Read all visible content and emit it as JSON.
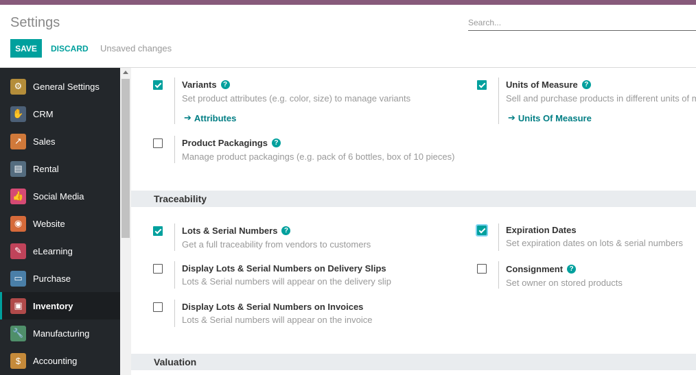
{
  "header": {
    "title": "Settings",
    "search_placeholder": "Search...",
    "save_label": "SAVE",
    "discard_label": "DISCARD",
    "unsaved_text": "Unsaved changes"
  },
  "sidebar": {
    "items": [
      {
        "label": "General Settings",
        "icon": "gear-icon",
        "color": "#b48d3a"
      },
      {
        "label": "CRM",
        "icon": "handshake-icon",
        "color": "#4c6077"
      },
      {
        "label": "Sales",
        "icon": "chart-icon",
        "color": "#d0793a"
      },
      {
        "label": "Rental",
        "icon": "rental-icon",
        "color": "#546c7f"
      },
      {
        "label": "Social Media",
        "icon": "thumbs-up-icon",
        "color": "#d54a74"
      },
      {
        "label": "Website",
        "icon": "globe-icon",
        "color": "#d56a3a"
      },
      {
        "label": "eLearning",
        "icon": "elearning-icon",
        "color": "#c0435a"
      },
      {
        "label": "Purchase",
        "icon": "credit-card-icon",
        "color": "#4a7fa8"
      },
      {
        "label": "Inventory",
        "icon": "box-icon",
        "color": "#b04a4a",
        "active": true
      },
      {
        "label": "Manufacturing",
        "icon": "wrench-icon",
        "color": "#4f8f6a"
      },
      {
        "label": "Accounting",
        "icon": "invoice-icon",
        "color": "#c58a3a"
      }
    ]
  },
  "products": {
    "variants": {
      "title": "Variants",
      "desc": "Set product attributes (e.g. color, size) to manage variants",
      "link": "Attributes",
      "checked": true
    },
    "uom": {
      "title": "Units of Measure",
      "desc": "Sell and purchase products in different units of m",
      "link": "Units Of Measure",
      "checked": true
    },
    "packagings": {
      "title": "Product Packagings",
      "desc": "Manage product packagings (e.g. pack of 6 bottles, box of 10 pieces)",
      "checked": false
    }
  },
  "traceability": {
    "section_title": "Traceability",
    "lots": {
      "title": "Lots & Serial Numbers",
      "desc": "Get a full traceability from vendors to customers",
      "checked": true
    },
    "expiration": {
      "title": "Expiration Dates",
      "desc": "Set expiration dates on lots & serial numbers",
      "checked": true
    },
    "delivery_slips": {
      "title": "Display Lots & Serial Numbers on Delivery Slips",
      "desc": "Lots & Serial numbers will appear on the delivery slip",
      "checked": false
    },
    "consignment": {
      "title": "Consignment",
      "desc": "Set owner on stored products",
      "checked": false
    },
    "invoices": {
      "title": "Display Lots & Serial Numbers on Invoices",
      "desc": "Lots & Serial numbers will appear on the invoice",
      "checked": false
    }
  },
  "valuation": {
    "section_title": "Valuation"
  },
  "colors": {
    "accent": "#00a09d",
    "topbar": "#875a7b",
    "sidebar_bg": "#23272b"
  }
}
